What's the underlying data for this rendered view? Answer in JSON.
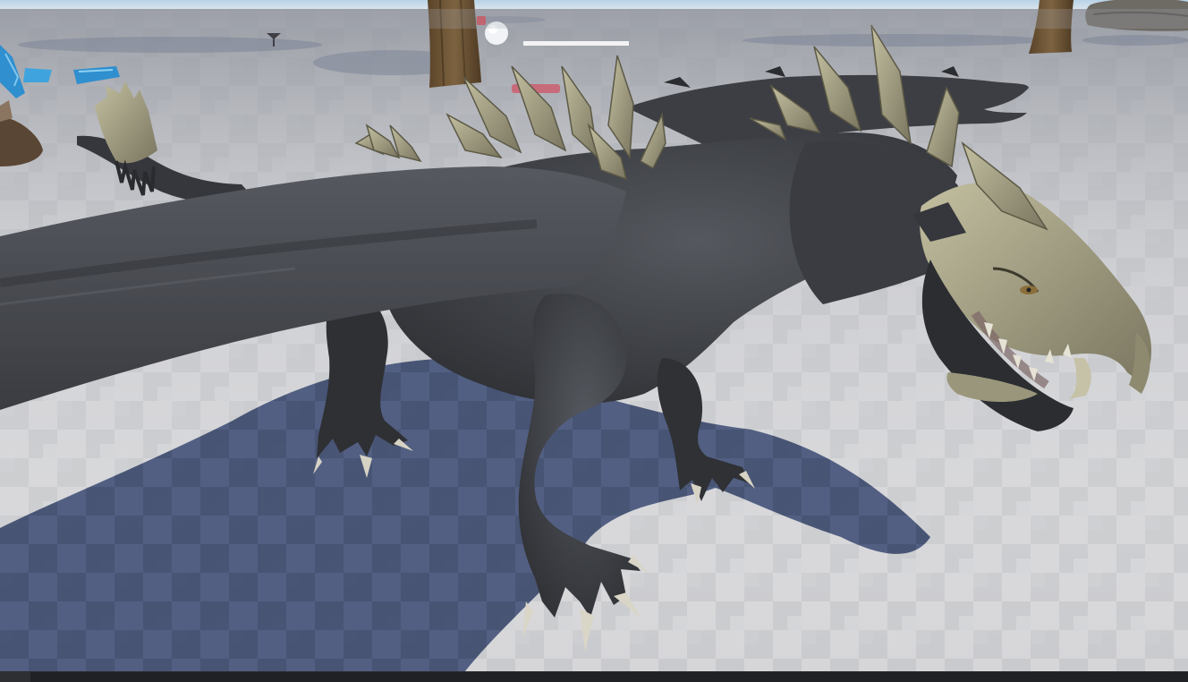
{
  "app": {
    "type": "3d-editor-viewport"
  },
  "scene": {
    "subject": "dragon-model",
    "colors": {
      "sky_strip": "#c9dce9",
      "floor_light": "#d9d9dc",
      "floor_dark": "#c4c5c9",
      "floor_far": "#9fa3ab",
      "shadow": "#3d4a6a",
      "dragon_body": "#3b3d41",
      "dragon_wing": "#4a4c51",
      "horn": "#a7a385",
      "bark": "#6b5436",
      "crystal": "#2f8fcf"
    }
  },
  "status_bar": {
    "corner_icon": "viewport-options-icon"
  }
}
